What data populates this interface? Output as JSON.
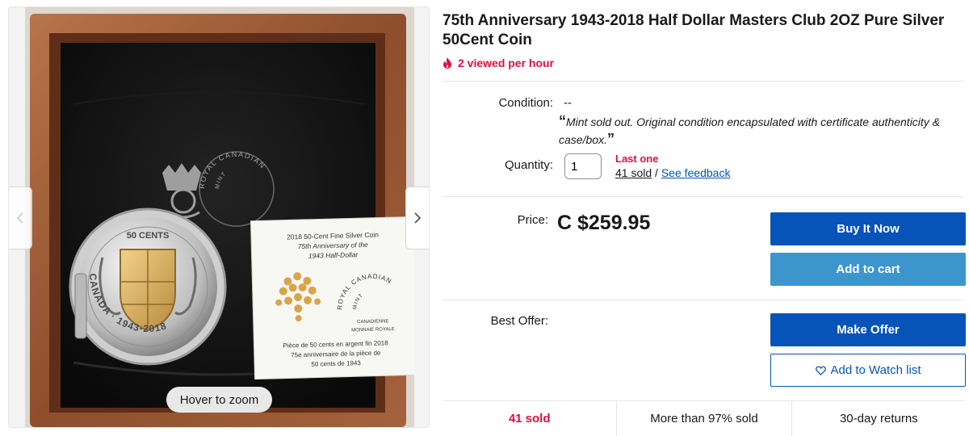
{
  "viewer": {
    "zoom_hint": "Hover to zoom",
    "icons": {
      "prev": "chevron-left-icon",
      "next": "chevron-right-icon"
    }
  },
  "listing": {
    "title": "75th Anniversary 1943-2018 Half Dollar Masters Club 2OZ Pure Silver 50Cent Coin",
    "views_per_hour": "2 viewed per hour",
    "views_icon": "flame-icon",
    "condition_label": "Condition:",
    "condition_value": "--",
    "condition_note": "Mint sold out. Original condition encapsulated with certificate authenticity & case/box.",
    "quantity_label": "Quantity:",
    "quantity_value": "1",
    "stock_status": "Last one",
    "sold_count": "41 sold",
    "separator": " / ",
    "feedback_link": "See feedback",
    "price_label": "Price:",
    "price": "C $259.95",
    "best_offer_label": "Best Offer:"
  },
  "buttons": {
    "buy_now": "Buy It Now",
    "add_to_cart": "Add to cart",
    "make_offer": "Make Offer",
    "watch_list": "Add to Watch list",
    "watch_icon": "heart-icon"
  },
  "stats": {
    "sold": "41 sold",
    "percent_sold": "More than 97% sold",
    "returns": "30-day returns"
  },
  "photo_text": {
    "coin_denomination": "50 CENTS",
    "coin_legend": "CANADA · 1943-2018",
    "card_line1": "2018 50-Cent Fine Silver Coin",
    "card_line2": "75th Anniversary of the",
    "card_line3": "1943 Half-Dollar",
    "card_fr1": "Pièce de 50 cents en argent fin 2018",
    "card_fr2": "75e anniversaire de la pièce de",
    "card_fr3": "50 cents de 1943",
    "mint_outer": "ROYAL CANADIAN",
    "mint_inner": "MINT",
    "mint_fr_inner": "CANADIENNE",
    "mint_fr_outer": "MONNAIE ROYALE"
  },
  "colors": {
    "accent_blue": "#0654ba",
    "cart_blue": "#3d95ce",
    "urgent_red": "#e0103a"
  }
}
